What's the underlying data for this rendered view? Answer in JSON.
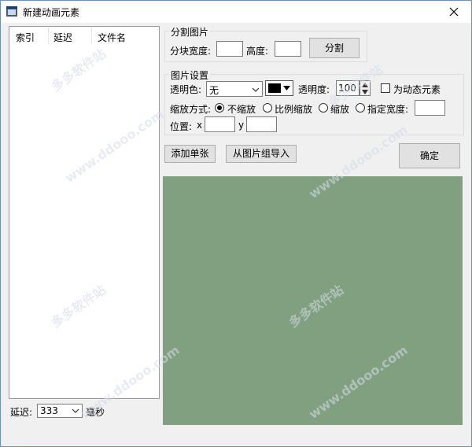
{
  "window": {
    "title": "新建动画元素"
  },
  "list": {
    "columns": [
      "索引",
      "延迟",
      "文件名"
    ],
    "rows": []
  },
  "delay": {
    "label": "延迟:",
    "value": "333",
    "unit": "毫秒"
  },
  "split": {
    "group_title": "分割图片",
    "width_label": "分块宽度:",
    "width_value": "",
    "height_label": "高度:",
    "height_value": "",
    "button": "分割"
  },
  "image_settings": {
    "group_title": "图片设置",
    "transparent_color_label": "透明色:",
    "transparent_color_value": "无",
    "color_swatch": "#000000",
    "opacity_label": "透明度:",
    "opacity_value": "100",
    "dynamic_label": "为动态元素",
    "dynamic_checked": false,
    "scale_label": "缩放方式:",
    "scale_options": [
      "不缩放",
      "比例缩放",
      "缩放",
      "指定宽度:"
    ],
    "scale_selected": 0,
    "specified_width_value": "",
    "position_label": "位置:",
    "x_label": "x",
    "x_value": "",
    "y_label": "y",
    "y_value": ""
  },
  "buttons": {
    "add_single": "添加单张",
    "import_group": "从图片组导入",
    "confirm": "确定"
  },
  "preview": {
    "background": "#80a080"
  },
  "watermarks": [
    "多多软件站",
    "www.ddooo.com"
  ]
}
